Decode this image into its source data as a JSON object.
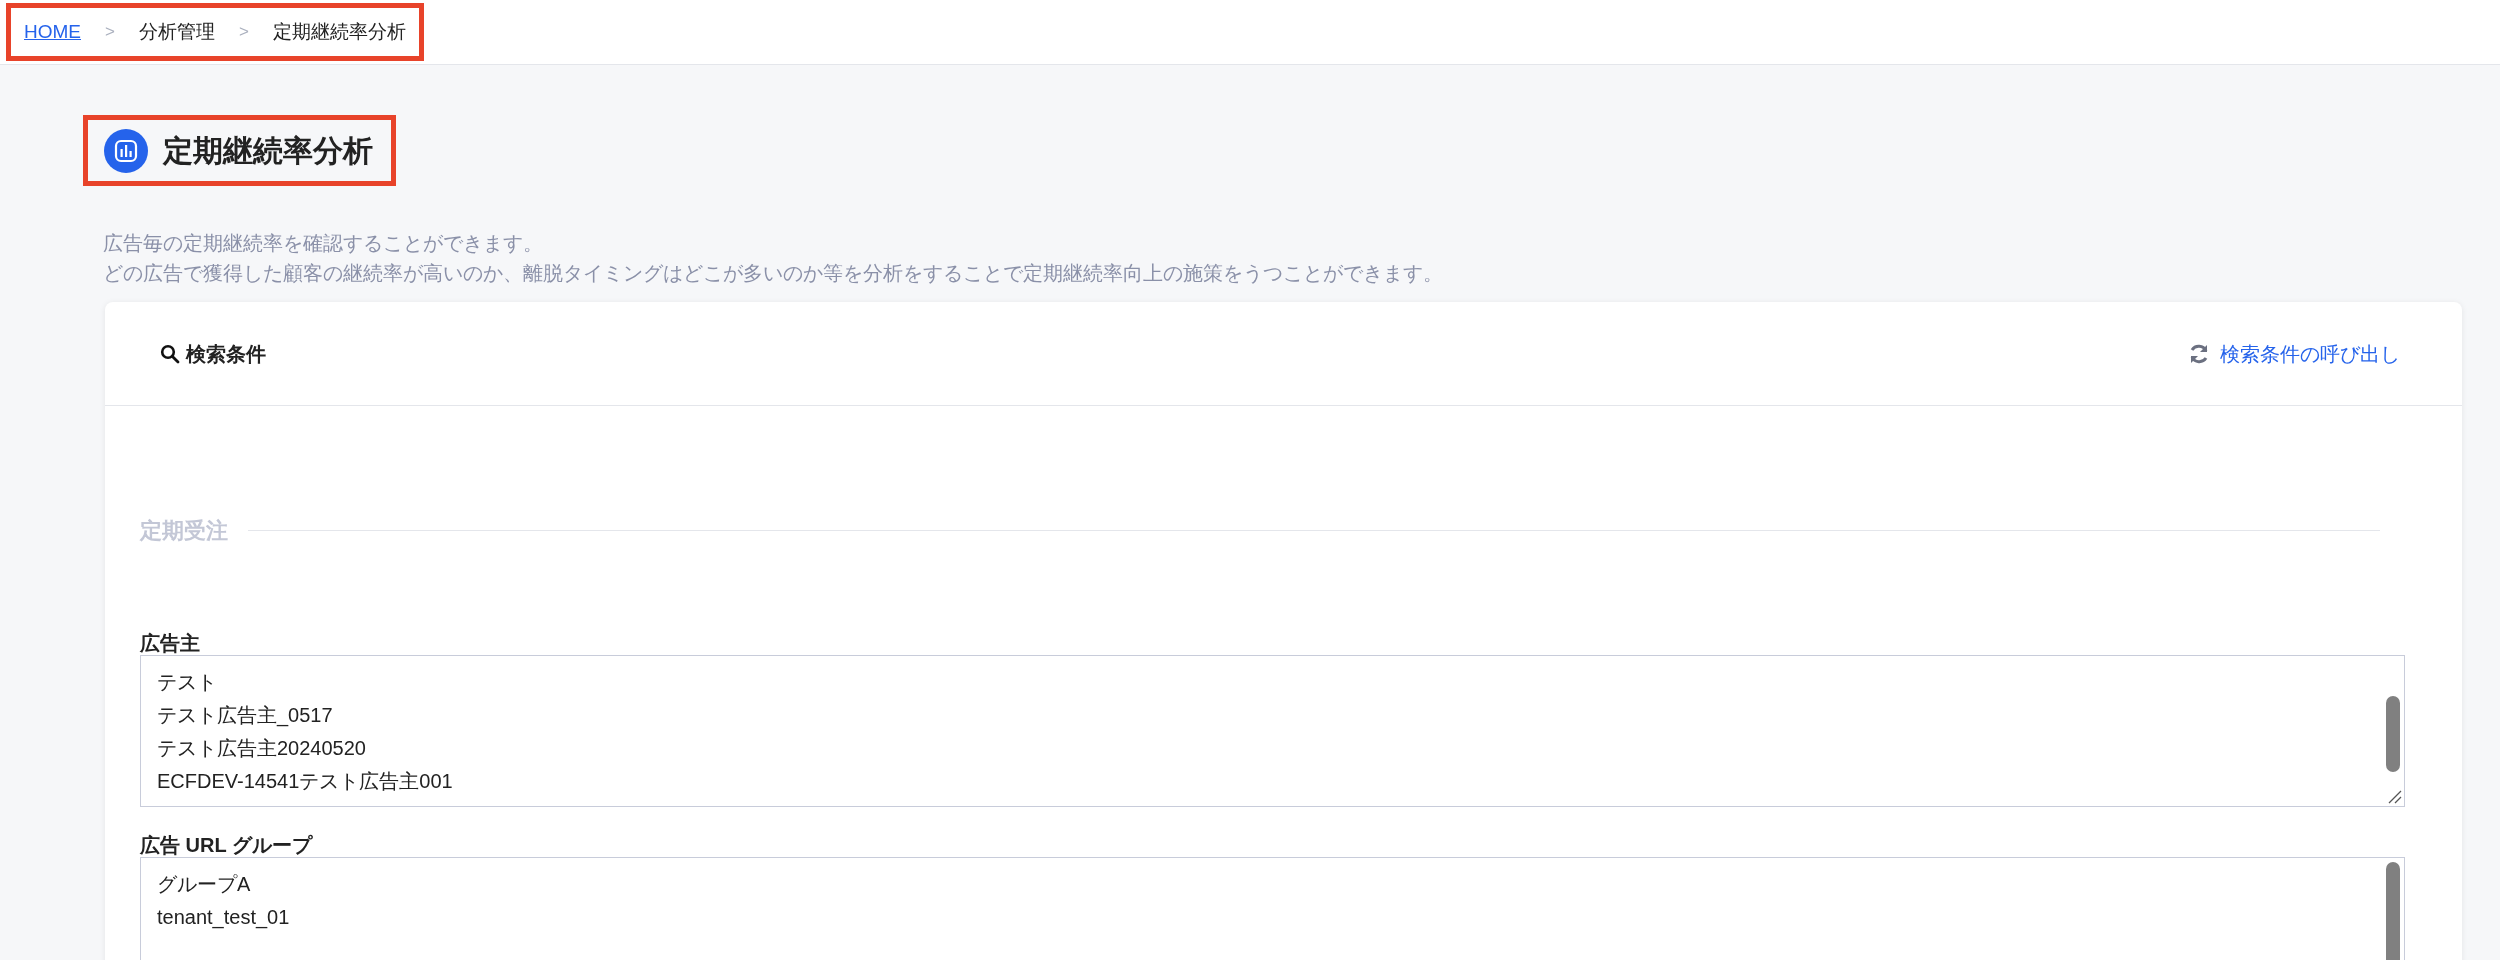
{
  "breadcrumb": {
    "separator": ">",
    "items": [
      {
        "label": "HOME",
        "kind": "link"
      },
      {
        "label": "分析管理",
        "kind": "text"
      },
      {
        "label": "定期継続率分析",
        "kind": "text"
      }
    ]
  },
  "page": {
    "title": "定期継続率分析",
    "description": [
      "広告毎の定期継続率を確認することができます。",
      "どの広告で獲得した顧客の継続率が高いのか、離脱タイミングはどこが多いのか等を分析をすることで定期継続率向上の施策をうつことができます。"
    ]
  },
  "search_panel": {
    "title": "検索条件",
    "recall_link": "検索条件の呼び出し",
    "section": "定期受注",
    "fields": [
      {
        "label": "広告主",
        "options": [
          "テスト",
          "テスト広告主_0517",
          "テスト広告主20240520",
          "ECFDEV-14541テスト広告主001"
        ]
      },
      {
        "label": "広告 URL グループ",
        "options": [
          "グループA",
          "tenant_test_01"
        ]
      }
    ]
  }
}
